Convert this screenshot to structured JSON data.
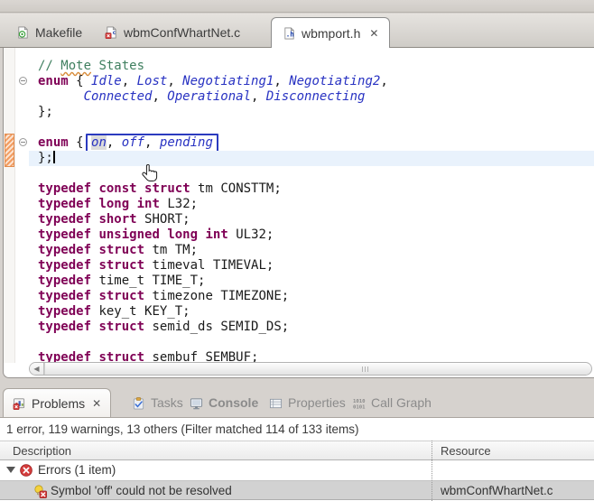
{
  "window": {
    "background": "#d6d2ce"
  },
  "editor_tabs": [
    {
      "label": "Makefile",
      "icon": "makefile-icon",
      "active": false
    },
    {
      "label": "wbmConfWhartNet.c",
      "icon": "c-file-error-icon",
      "active": false
    },
    {
      "label": "wbmport.h",
      "icon": "h-file-icon",
      "active": true,
      "close_glyph": "✕"
    }
  ],
  "editor": {
    "lines": [
      {
        "tokens": [
          {
            "t": "// ",
            "s": "cm"
          },
          {
            "t": "Mote",
            "s": "cm sp"
          },
          {
            "t": " States",
            "s": "cm"
          }
        ]
      },
      {
        "fold": true,
        "tokens": [
          {
            "t": "enum",
            "s": "kw"
          },
          {
            "t": " { ",
            "s": "pl"
          },
          {
            "t": "Idle",
            "s": "en"
          },
          {
            "t": ", ",
            "s": "pl"
          },
          {
            "t": "Lost",
            "s": "en"
          },
          {
            "t": ", ",
            "s": "pl"
          },
          {
            "t": "Negotiating1",
            "s": "en"
          },
          {
            "t": ", ",
            "s": "pl"
          },
          {
            "t": "Negotiating2",
            "s": "en"
          },
          {
            "t": ",",
            "s": "pl"
          }
        ]
      },
      {
        "tokens": [
          {
            "t": "      ",
            "s": "pl"
          },
          {
            "t": "Connected",
            "s": "en"
          },
          {
            "t": ", ",
            "s": "pl"
          },
          {
            "t": "Operational",
            "s": "en"
          },
          {
            "t": ", ",
            "s": "pl"
          },
          {
            "t": "Disconnecting",
            "s": "en"
          }
        ]
      },
      {
        "tokens": [
          {
            "t": "};",
            "s": "pl"
          }
        ]
      },
      {
        "tokens": []
      },
      {
        "fold": true,
        "box": true,
        "tokens": [
          {
            "t": "enum",
            "s": "kw"
          },
          {
            "t": " { ",
            "s": "pl"
          },
          {
            "t": "on",
            "s": "en occ"
          },
          {
            "t": ", ",
            "s": "pl"
          },
          {
            "t": "off",
            "s": "en"
          },
          {
            "t": ", ",
            "s": "pl"
          },
          {
            "t": "pending",
            "s": "en"
          }
        ]
      },
      {
        "current": true,
        "caret": true,
        "tokens": [
          {
            "t": "};",
            "s": "pl"
          }
        ]
      },
      {
        "tokens": []
      },
      {
        "tokens": [
          {
            "t": "typedef",
            "s": "kw"
          },
          {
            "t": " ",
            "s": "pl"
          },
          {
            "t": "const",
            "s": "kw"
          },
          {
            "t": " ",
            "s": "pl"
          },
          {
            "t": "struct",
            "s": "kw"
          },
          {
            "t": " tm CONSTTM;",
            "s": "pl"
          }
        ]
      },
      {
        "tokens": [
          {
            "t": "typedef",
            "s": "kw"
          },
          {
            "t": " ",
            "s": "pl"
          },
          {
            "t": "long",
            "s": "kw"
          },
          {
            "t": " ",
            "s": "pl"
          },
          {
            "t": "int",
            "s": "kw"
          },
          {
            "t": " L32;",
            "s": "pl"
          }
        ]
      },
      {
        "tokens": [
          {
            "t": "typedef",
            "s": "kw"
          },
          {
            "t": " ",
            "s": "pl"
          },
          {
            "t": "short",
            "s": "kw"
          },
          {
            "t": " SHORT;",
            "s": "pl"
          }
        ]
      },
      {
        "tokens": [
          {
            "t": "typedef",
            "s": "kw"
          },
          {
            "t": " ",
            "s": "pl"
          },
          {
            "t": "unsigned",
            "s": "kw"
          },
          {
            "t": " ",
            "s": "pl"
          },
          {
            "t": "long",
            "s": "kw"
          },
          {
            "t": " ",
            "s": "pl"
          },
          {
            "t": "int",
            "s": "kw"
          },
          {
            "t": " UL32;",
            "s": "pl"
          }
        ]
      },
      {
        "tokens": [
          {
            "t": "typedef",
            "s": "kw"
          },
          {
            "t": " ",
            "s": "pl"
          },
          {
            "t": "struct",
            "s": "kw"
          },
          {
            "t": " tm TM;",
            "s": "pl"
          }
        ]
      },
      {
        "tokens": [
          {
            "t": "typedef",
            "s": "kw"
          },
          {
            "t": " ",
            "s": "pl"
          },
          {
            "t": "struct",
            "s": "kw"
          },
          {
            "t": " timeval TIMEVAL;",
            "s": "pl"
          }
        ]
      },
      {
        "tokens": [
          {
            "t": "typedef",
            "s": "kw"
          },
          {
            "t": " time_t TIME_T;",
            "s": "pl"
          }
        ]
      },
      {
        "tokens": [
          {
            "t": "typedef",
            "s": "kw"
          },
          {
            "t": " ",
            "s": "pl"
          },
          {
            "t": "struct",
            "s": "kw"
          },
          {
            "t": " timezone TIMEZONE;",
            "s": "pl"
          }
        ]
      },
      {
        "tokens": [
          {
            "t": "typedef",
            "s": "kw"
          },
          {
            "t": " key_t KEY_T;",
            "s": "pl"
          }
        ]
      },
      {
        "tokens": [
          {
            "t": "typedef",
            "s": "kw"
          },
          {
            "t": " ",
            "s": "pl"
          },
          {
            "t": "struct",
            "s": "kw"
          },
          {
            "t": " semid_ds SEMID_DS;",
            "s": "pl"
          }
        ]
      },
      {
        "tokens": []
      },
      {
        "tokens": [
          {
            "t": "typedef",
            "s": "kw"
          },
          {
            "t": " ",
            "s": "pl"
          },
          {
            "t": "struct",
            "s": "kw"
          },
          {
            "t": " sembuf SEMBUF;",
            "s": "pl"
          }
        ]
      }
    ]
  },
  "bottom_panel": {
    "tabs": [
      {
        "label": "Problems",
        "icon": "problems-icon",
        "active": true,
        "close_glyph": "✕"
      },
      {
        "label": "Tasks",
        "icon": "tasks-icon"
      },
      {
        "label": "Console",
        "icon": "console-icon",
        "bold": true
      },
      {
        "label": "Properties",
        "icon": "properties-icon"
      },
      {
        "label": "Call Graph",
        "icon": "call-graph-icon"
      }
    ],
    "summary": "1 error, 119 warnings, 13 others (Filter matched 114 of 133 items)",
    "table": {
      "columns": [
        "Description",
        "Resource"
      ],
      "group_row": {
        "label": "Errors (1 item)",
        "expanded": true
      },
      "rows": [
        {
          "description": "Symbol 'off' could not be resolved",
          "resource": "wbmConfWhartNet.c",
          "selected": true
        }
      ]
    }
  },
  "colors": {
    "keyword": "#7f0055",
    "enumerator": "#2832c2",
    "comment": "#3f7f5f",
    "selection_box": "#2b3bbf",
    "error_red": "#cc3333",
    "marker_orange": "#f29c61",
    "current_line": "#e9f2fc"
  }
}
